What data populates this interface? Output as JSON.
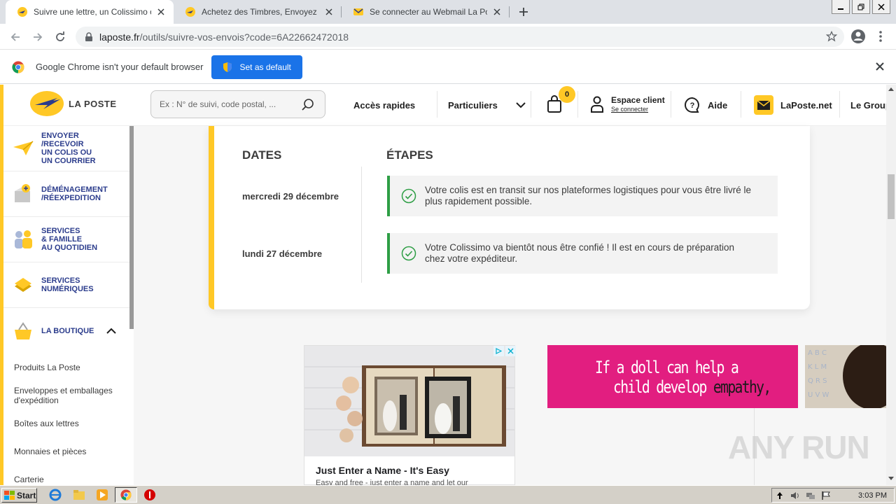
{
  "browser": {
    "tabs": [
      {
        "title": "Suivre une lettre, un Colissimo ou un",
        "active": true,
        "favicon": "laposte-favicon"
      },
      {
        "title": "Achetez des Timbres, Envoyez Courr",
        "active": false,
        "favicon": "laposte-favicon"
      },
      {
        "title": "Se connecter au Webmail La Poste -",
        "active": false,
        "favicon": "mail-favicon"
      }
    ],
    "url_domain": "laposte.fr",
    "url_path": "/outils/suivre-vos-envois?code=6A22662472018"
  },
  "infobar": {
    "message": "Google Chrome isn't your default browser",
    "button": "Set as default"
  },
  "header": {
    "logo": "LA POSTE",
    "search_placeholder": "Ex : N° de suivi, code postal, ...",
    "quick_access": "Accès rapides",
    "segment": "Particuliers",
    "cart_count": "0",
    "account_title": "Espace client",
    "account_link": "Se connecter",
    "help": "Aide",
    "webmail": "LaPoste.net",
    "group": "Le Group"
  },
  "sidebar": {
    "items": [
      {
        "label": "ENVOYER\n/RECEVOIR\nUN COLIS OU\nUN COURRIER",
        "icon": "paper-plane-icon"
      },
      {
        "label": "DÉMÉNAGEMENT\n/RÉEXPEDITION",
        "icon": "moving-box-icon"
      },
      {
        "label": "SERVICES\n& FAMILLE\nAU QUOTIDIEN",
        "icon": "family-icon"
      },
      {
        "label": "SERVICES\nNUMÉRIQUES",
        "icon": "digital-icon"
      },
      {
        "label": "LA BOUTIQUE",
        "icon": "shop-basket-icon"
      }
    ],
    "shop_links": [
      "Produits La Poste",
      "Enveloppes et emballages\nd'expédition",
      "Boîtes aux lettres",
      "Monnaies et pièces",
      "Carterie"
    ]
  },
  "tracking": {
    "dates_header": "DATES",
    "steps_header": "ÉTAPES",
    "events": [
      {
        "date": "mercredi 29 décembre",
        "text": "Votre colis est en transit sur nos plateformes logistiques pour vous être livré le plus rapidement possible."
      },
      {
        "date": "lundi 27 décembre",
        "text": "Votre Colissimo va bientôt nous être confié ! Il est en cours de préparation chez votre expéditeur."
      }
    ]
  },
  "ads": {
    "ad1_title": "Just Enter a Name - It's Easy",
    "ad1_sub": "Easy and free - just enter a name and let our",
    "ad2_line1": "If a doll can help a",
    "ad2_line2a": "child develop ",
    "ad2_line2b": "empathy,"
  },
  "watermark": "ANY RUN",
  "taskbar": {
    "start": "Start",
    "clock": "3:03 PM"
  },
  "colors": {
    "laposte_yellow": "#ffc826",
    "laposte_blue": "#2b3c8c",
    "chrome_blue": "#1a73e8",
    "step_green": "#2e9e45",
    "ad_pink": "#e21e80"
  }
}
